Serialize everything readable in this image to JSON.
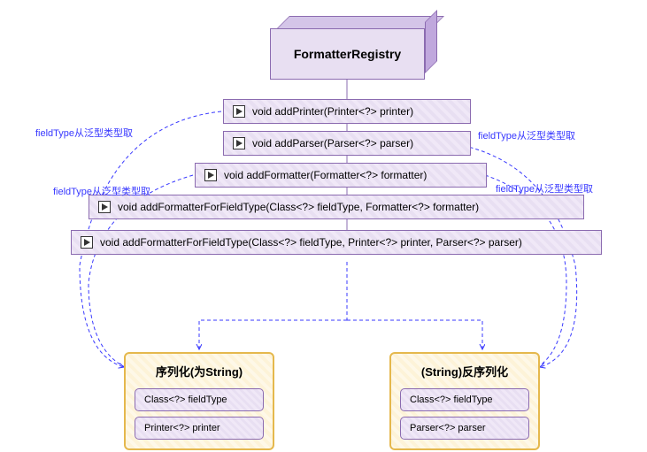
{
  "header": {
    "title": "FormatterRegistry"
  },
  "methods": {
    "m1": "void addPrinter(Printer<?> printer)",
    "m2": "void addParser(Parser<?> parser)",
    "m3": "void addFormatter(Formatter<?> formatter)",
    "m4": "void addFormatterForFieldType(Class<?> fieldType, Formatter<?> formatter)",
    "m5": "void addFormatterForFieldType(Class<?> fieldType, Printer<?> printer, Parser<?> parser)"
  },
  "annotations": {
    "a1": "fieldType从泛型类型取",
    "a2": "fieldType从泛型类型取",
    "a3": "fieldType从泛型类型取",
    "a4": "fieldType从泛型类型取"
  },
  "results": {
    "left": {
      "title": "序列化(为String)",
      "item1": "Class<?> fieldType",
      "item2": "Printer<?> printer"
    },
    "right": {
      "title": "(String)反序列化",
      "item1": "Class<?> fieldType",
      "item2": "Parser<?> parser"
    }
  }
}
